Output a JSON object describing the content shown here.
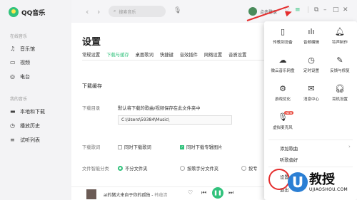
{
  "app": {
    "name": "QQ音乐"
  },
  "sidebar": {
    "section_online": "在线音乐",
    "online_items": [
      {
        "label": "音乐馆",
        "icon": "music-note-icon"
      },
      {
        "label": "视频",
        "icon": "video-icon"
      },
      {
        "label": "电台",
        "icon": "radio-icon"
      }
    ],
    "section_mine": "我的音乐",
    "mine_items": [
      {
        "label": "本地和下载",
        "icon": "computer-icon"
      },
      {
        "label": "播放历史",
        "icon": "history-icon"
      },
      {
        "label": "试听列表",
        "icon": "playlist-icon"
      }
    ]
  },
  "topbar": {
    "search_placeholder": "搜索音乐",
    "login_label": "点击登录"
  },
  "settings": {
    "title": "设置",
    "tabs": [
      "常规设置",
      "下载与缓存",
      "桌面歌词",
      "快捷键",
      "音效插件",
      "网络设置",
      "音质设置"
    ],
    "active_tab": "下载与缓存",
    "section_title": "下载缓存",
    "dir_label": "下载目录",
    "dir_desc": "默认将下载的歌曲/视频保存在此文件夹中",
    "dir_path": "C:\\Users\\59384\\Music\\",
    "lyric_label": "下载歌词",
    "lyric_opt1": "同时下载歌词",
    "lyric_opt2": "同时下载专辑图片",
    "classify_label": "文件智能分类",
    "classify_opt1": "不分文件夹",
    "classify_opt2": "按歌手分文件夹",
    "classify_opt3": "按专"
  },
  "player": {
    "song": "ai的猪大来自于你的孤独",
    "artist": "韩蕴清"
  },
  "menu": {
    "grid": [
      {
        "label": "传歌到设备",
        "icon": "phone-icon"
      },
      {
        "label": "音频编辑",
        "icon": "audio-edit-icon"
      },
      {
        "label": "铃声制作",
        "icon": "bell-icon"
      },
      {
        "label": "微云音乐网盘",
        "icon": "cloud-icon"
      },
      {
        "label": "定时设置",
        "icon": "clock-icon"
      },
      {
        "label": "反馈与修复",
        "icon": "feedback-icon"
      },
      {
        "label": "游戏优化",
        "icon": "game-icon"
      },
      {
        "label": "消息中心",
        "icon": "mail-icon"
      },
      {
        "label": "耳机设置",
        "icon": "headphone-icon"
      },
      {
        "label": "虚拟麦克风",
        "icon": "microphone-icon"
      }
    ],
    "badge": "NEW",
    "add_song": "添加歌曲",
    "listen_pref": "听歌偏好",
    "settings": "设置",
    "exit": "退出"
  },
  "watermark": {
    "letter": "U",
    "title": "教授",
    "site": "UJIAOSHOU.COM"
  },
  "colors": {
    "accent": "#31c27c",
    "annotation": "#e52d2d"
  }
}
